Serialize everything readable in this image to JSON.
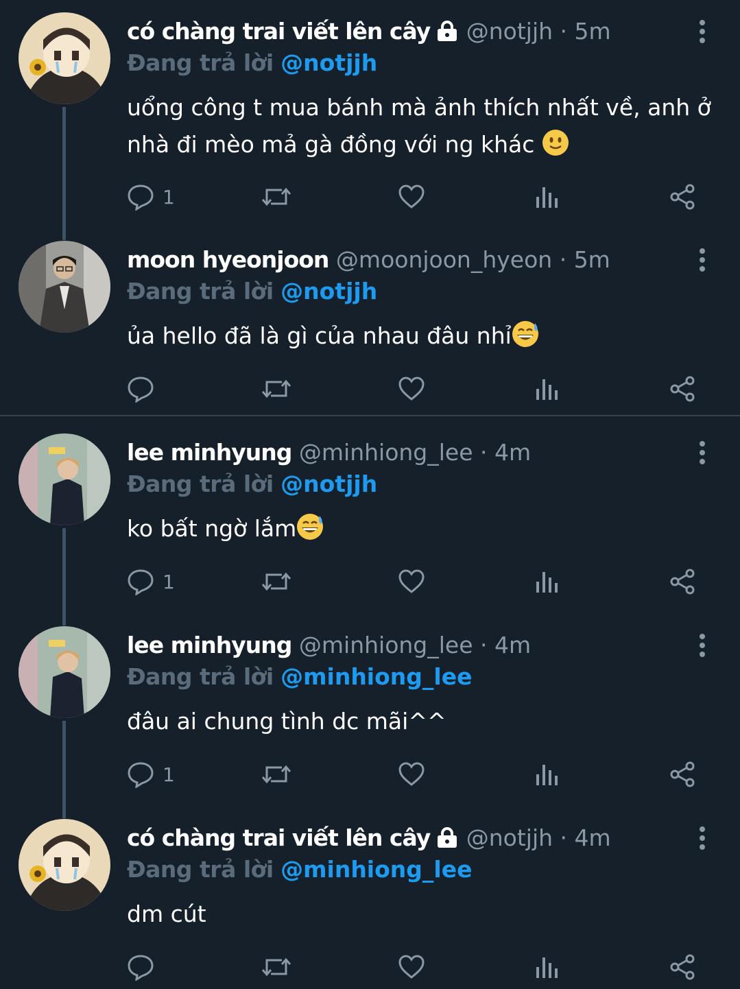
{
  "colors": {
    "background": "#15202b",
    "muted": "#8b98a5",
    "link": "#1d9bf0",
    "thread_line": "#3d5466"
  },
  "tweets": [
    {
      "name": "có chàng trai viết lên cây",
      "locked": true,
      "handle": "@notjjh",
      "dot": "·",
      "time": "5m",
      "reply_label": "Đang trả lời",
      "reply_to": "@notjjh",
      "text": "uổng công t mua bánh mà ảnh thích nhất về, anh ở nhà đi mèo mả gà đồng với ng khác",
      "emoji": "slightly-smiling-face",
      "reply_count": "1",
      "avatar": "cartoon-boy-with-sunflower"
    },
    {
      "name": "moon hyeonjoon",
      "locked": false,
      "handle": "@moonjoon_hyeon",
      "dot": "·",
      "time": "5m",
      "reply_label": "Đang trả lời",
      "reply_to": "@notjjh",
      "text": "ủa hello đã là gì của nhau đâu nhỉ",
      "emoji": "grinning-face-with-sweat",
      "reply_count": "",
      "avatar": "man-in-suit-photo"
    },
    {
      "name": "lee minhyung",
      "locked": false,
      "handle": "@minhiong_lee",
      "dot": "·",
      "time": "4m",
      "reply_label": "Đang trả lời",
      "reply_to": "@notjjh",
      "text": "ko bất ngờ lắm",
      "emoji": "grinning-face-with-sweat",
      "reply_count": "1",
      "avatar": "man-in-hallway-photo"
    },
    {
      "name": "lee minhyung",
      "locked": false,
      "handle": "@minhiong_lee",
      "dot": "·",
      "time": "4m",
      "reply_label": "Đang trả lời",
      "reply_to": "@minhiong_lee",
      "text": "đâu ai chung tình dc mãi^^",
      "emoji": "",
      "reply_count": "1",
      "avatar": "man-in-hallway-photo"
    },
    {
      "name": "có chàng trai viết lên cây",
      "locked": true,
      "handle": "@notjjh",
      "dot": "·",
      "time": "4m",
      "reply_label": "Đang trả lời",
      "reply_to": "@minhiong_lee",
      "text": "dm cút",
      "emoji": "",
      "reply_count": "",
      "avatar": "cartoon-boy-with-sunflower"
    }
  ]
}
